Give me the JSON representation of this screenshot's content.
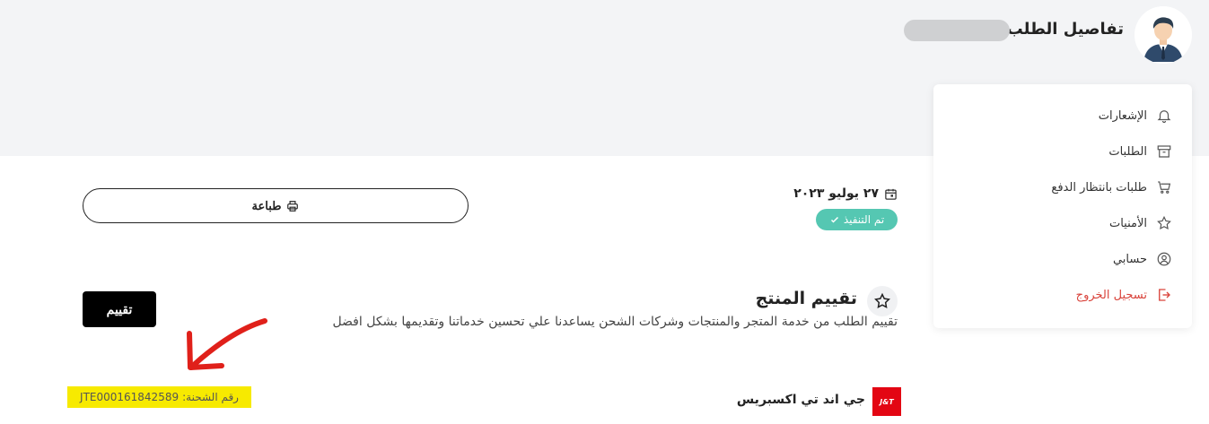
{
  "header": {
    "title": "تفاصيل الطلب #"
  },
  "menu": {
    "items": [
      {
        "label": "الإشعارات",
        "icon": "bell-icon"
      },
      {
        "label": "الطلبات",
        "icon": "box-icon"
      },
      {
        "label": "طلبات بانتظار الدفع",
        "icon": "cart-icon"
      },
      {
        "label": "الأمنيات",
        "icon": "star-icon"
      },
      {
        "label": "حسابي",
        "icon": "user-icon"
      },
      {
        "label": "تسجيل الخروج",
        "icon": "logout-icon"
      }
    ]
  },
  "order": {
    "date": "٢٧ يوليو ٢٠٢٣",
    "status": "تم التنفيذ",
    "print_label": "طباعة"
  },
  "rating": {
    "title": "تقييم المنتج",
    "description": "تقييم الطلب من خدمة المتجر والمنتجات وشركات الشحن يساعدنا علي تحسين خدماتنا وتقديمها بشكل افضل",
    "button_label": "تقييم"
  },
  "shipping": {
    "carrier_name": "جي اند تي اكسبريس",
    "carrier_logo_text": "J&T",
    "tracking_label": "رقم الشحنة:",
    "tracking_number": "JTE000161842589"
  },
  "colors": {
    "status_green": "#55c7b2",
    "logout_red": "#d9433b",
    "highlight_yellow": "#f7ea00",
    "annotation_red": "#e0201a"
  }
}
